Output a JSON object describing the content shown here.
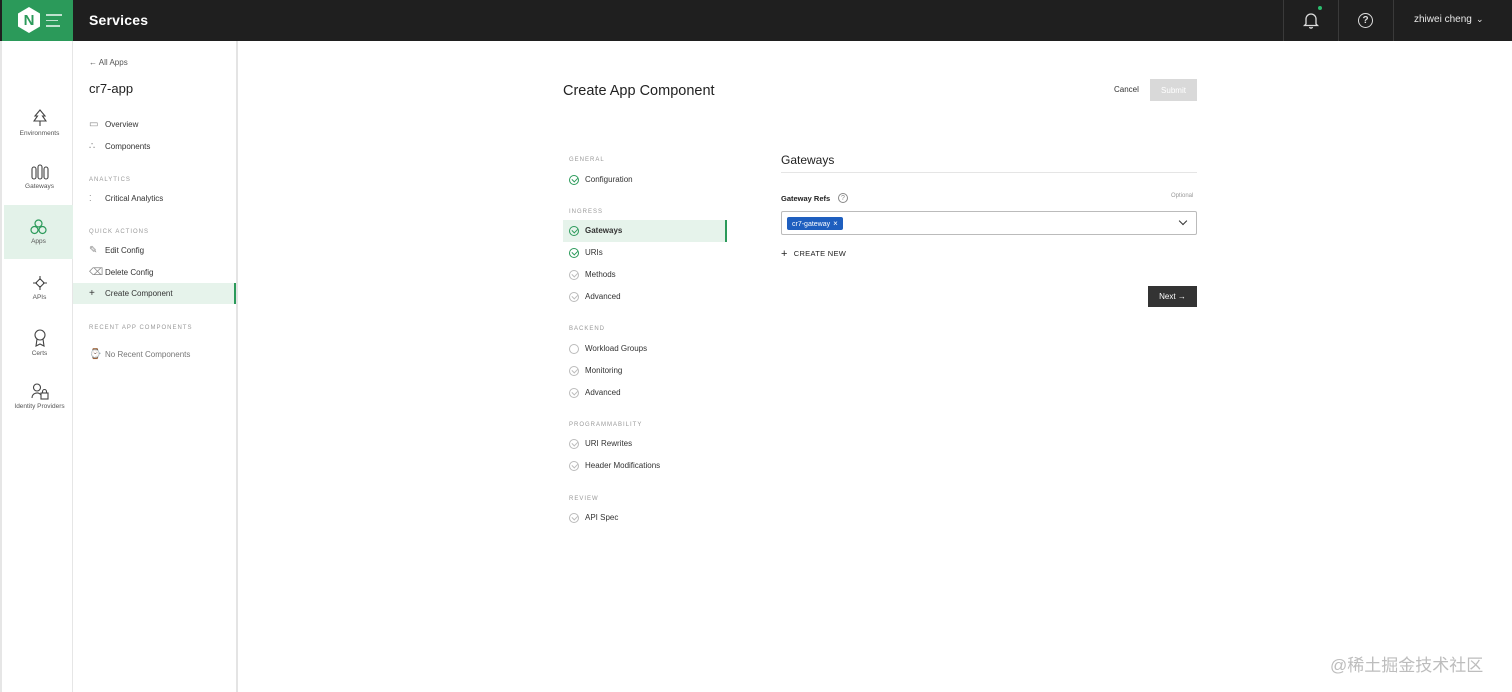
{
  "header": {
    "logo_letter": "N",
    "title": "Services",
    "user_name": "zhiwei cheng"
  },
  "rail": {
    "items": [
      {
        "label": "Environments",
        "icon": "tree-icon"
      },
      {
        "label": "Gateways",
        "icon": "gateways-icon"
      },
      {
        "label": "Apps",
        "icon": "apps-icon"
      },
      {
        "label": "APIs",
        "icon": "apis-icon"
      },
      {
        "label": "Certs",
        "icon": "certs-icon"
      },
      {
        "label": "Identity Providers",
        "icon": "identity-providers-icon"
      }
    ],
    "active": "Apps"
  },
  "subnav": {
    "back_label": "All Apps",
    "app_name": "cr7-app",
    "items": [
      {
        "label": "Overview",
        "icon": "monitor-icon"
      },
      {
        "label": "Components",
        "icon": "components-icon"
      }
    ],
    "analytics_head": "ANALYTICS",
    "analytics_items": [
      {
        "label": "Critical Analytics",
        "icon": "chart-icon"
      }
    ],
    "quick_actions_head": "QUICK ACTIONS",
    "quick_actions": [
      {
        "label": "Edit Config",
        "icon": "edit-icon"
      },
      {
        "label": "Delete Config",
        "icon": "delete-icon"
      },
      {
        "label": "Create Component",
        "icon": "plus-icon"
      }
    ],
    "recent_head": "RECENT APP COMPONENTS",
    "recent_empty": "No Recent Components"
  },
  "main": {
    "title": "Create App Component",
    "cancel_label": "Cancel",
    "submit_label": "Submit",
    "steps": {
      "general_head": "GENERAL",
      "general": [
        "Configuration"
      ],
      "ingress_head": "INGRESS",
      "ingress": [
        "Gateways",
        "URIs",
        "Methods",
        "Advanced"
      ],
      "backend_head": "BACKEND",
      "backend": [
        "Workload Groups",
        "Monitoring",
        "Advanced"
      ],
      "programmability_head": "PROGRAMMABILITY",
      "programmability": [
        "URI Rewrites",
        "Header Modifications"
      ],
      "review_head": "REVIEW",
      "review": [
        "API Spec"
      ]
    },
    "section_title": "Gateways",
    "gateway_refs_label": "Gateway Refs",
    "optional_label": "Optional",
    "selected_gateway": "cr7-gateway",
    "create_new_label": "CREATE NEW",
    "next_label": "Next →"
  },
  "watermark": "@稀土掘金技术社区",
  "colors": {
    "brand_green": "#2b9a5a",
    "chip_blue": "#1f5fbf",
    "topbar": "#1f1f1f"
  }
}
